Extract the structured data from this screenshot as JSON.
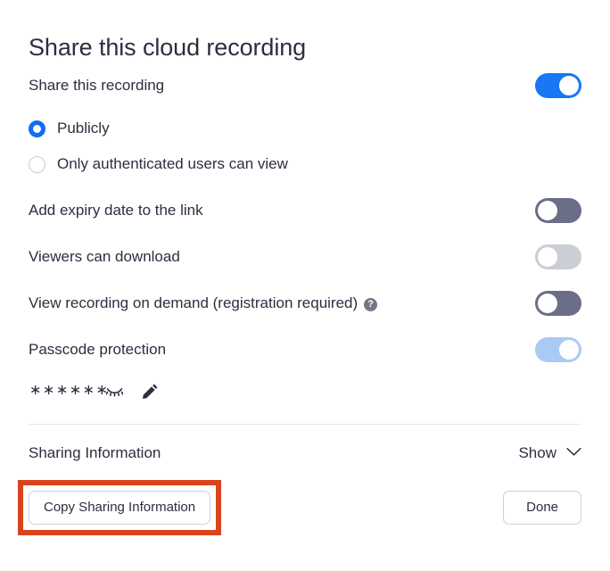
{
  "dialog": {
    "title": "Share this cloud recording"
  },
  "settings": [
    {
      "label": "Share this recording",
      "name": "share-this-recording",
      "toggle": {
        "state": "on",
        "color": "#1877f2",
        "style": "t-blue"
      }
    },
    {
      "label": "Add expiry date to the link",
      "name": "add-expiry-date",
      "toggle": {
        "state": "off",
        "color": "#6b6e87",
        "style": "t-slate"
      }
    },
    {
      "label": "Viewers can download",
      "name": "viewers-can-download",
      "toggle": {
        "state": "off",
        "color": "#ccced6",
        "style": "t-gray"
      }
    },
    {
      "label": "View recording on demand (registration required)",
      "name": "view-on-demand",
      "help_icon": "?",
      "toggle": {
        "state": "off",
        "color": "#6b6e87",
        "style": "t-slate"
      }
    },
    {
      "label": "Passcode protection",
      "name": "passcode-protection",
      "toggle": {
        "state": "on",
        "color": "#a9caf4",
        "style": "t-lightblue"
      }
    }
  ],
  "access_options": [
    {
      "label": "Publicly",
      "selected": true
    },
    {
      "label": "Only authenticated users can view",
      "selected": false
    }
  ],
  "passcode": {
    "masked_value": "∗∗∗∗∗∗",
    "hide_icon": "eye-off-icon",
    "edit_icon": "pencil-icon"
  },
  "sharing_information": {
    "title": "Sharing Information",
    "show_label": "Show",
    "chevron": "chevron-down-icon"
  },
  "footer": {
    "copy_label": "Copy Sharing Information",
    "done_label": "Done"
  },
  "annotation": {
    "color": "#d9451b"
  }
}
